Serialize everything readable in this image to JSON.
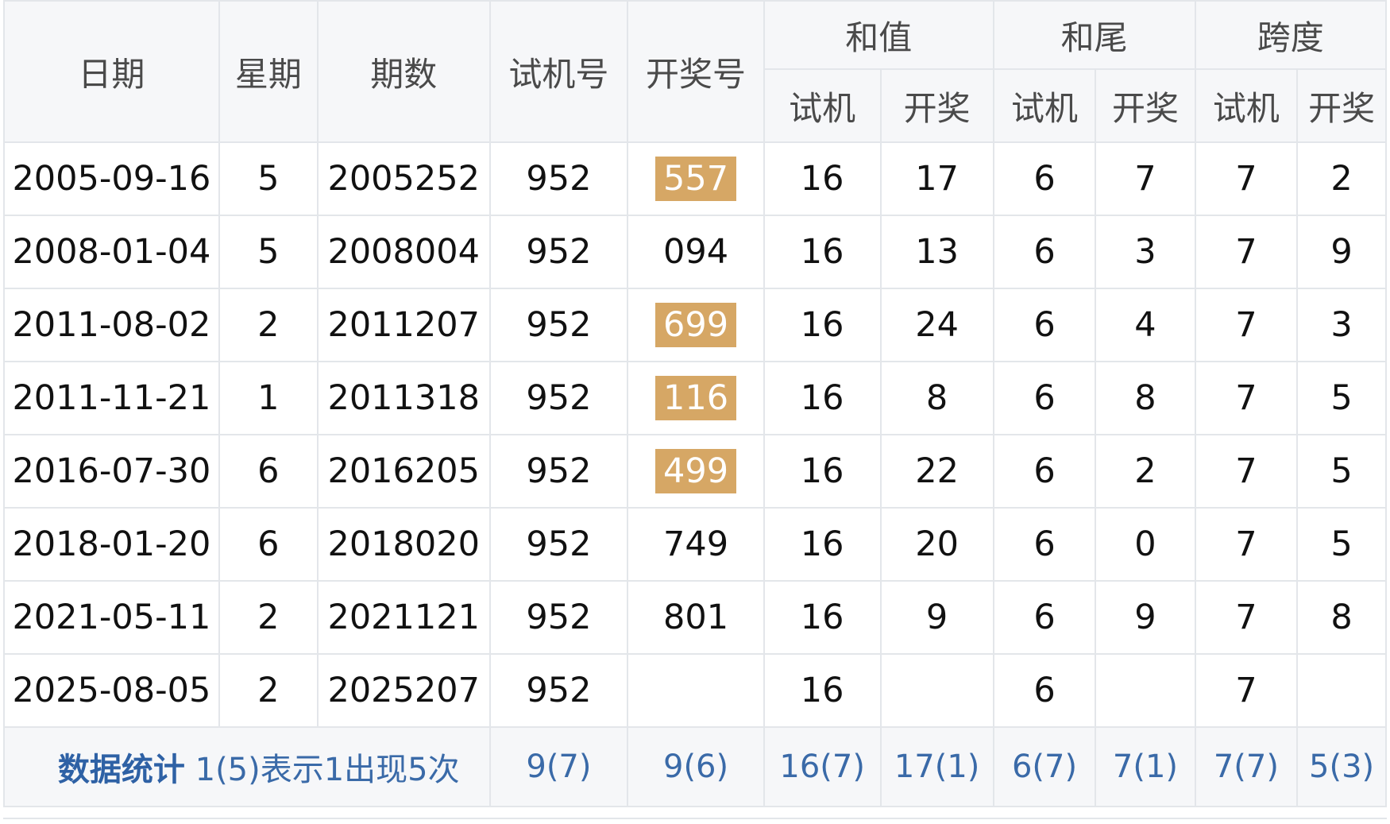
{
  "headers": {
    "date": "日期",
    "weekday": "星期",
    "period": "期数",
    "trial": "试机号",
    "draw": "开奖号",
    "sum": "和值",
    "tail": "和尾",
    "span": "跨度",
    "sub_trial": "试机",
    "sub_draw": "开奖"
  },
  "rows": [
    {
      "date": "2005-09-16",
      "weekday": "5",
      "period": "2005252",
      "trial": "952",
      "draw": "557",
      "highlight": true,
      "sum_t": "16",
      "sum_d": "17",
      "tail_t": "6",
      "tail_d": "7",
      "span_t": "7",
      "span_d": "2"
    },
    {
      "date": "2008-01-04",
      "weekday": "5",
      "period": "2008004",
      "trial": "952",
      "draw": "094",
      "highlight": false,
      "sum_t": "16",
      "sum_d": "13",
      "tail_t": "6",
      "tail_d": "3",
      "span_t": "7",
      "span_d": "9"
    },
    {
      "date": "2011-08-02",
      "weekday": "2",
      "period": "2011207",
      "trial": "952",
      "draw": "699",
      "highlight": true,
      "sum_t": "16",
      "sum_d": "24",
      "tail_t": "6",
      "tail_d": "4",
      "span_t": "7",
      "span_d": "3"
    },
    {
      "date": "2011-11-21",
      "weekday": "1",
      "period": "2011318",
      "trial": "952",
      "draw": "116",
      "highlight": true,
      "sum_t": "16",
      "sum_d": "8",
      "tail_t": "6",
      "tail_d": "8",
      "span_t": "7",
      "span_d": "5"
    },
    {
      "date": "2016-07-30",
      "weekday": "6",
      "period": "2016205",
      "trial": "952",
      "draw": "499",
      "highlight": true,
      "sum_t": "16",
      "sum_d": "22",
      "tail_t": "6",
      "tail_d": "2",
      "span_t": "7",
      "span_d": "5"
    },
    {
      "date": "2018-01-20",
      "weekday": "6",
      "period": "2018020",
      "trial": "952",
      "draw": "749",
      "highlight": false,
      "sum_t": "16",
      "sum_d": "20",
      "tail_t": "6",
      "tail_d": "0",
      "span_t": "7",
      "span_d": "5"
    },
    {
      "date": "2021-05-11",
      "weekday": "2",
      "period": "2021121",
      "trial": "952",
      "draw": "801",
      "highlight": false,
      "sum_t": "16",
      "sum_d": "9",
      "tail_t": "6",
      "tail_d": "9",
      "span_t": "7",
      "span_d": "8"
    },
    {
      "date": "2025-08-05",
      "weekday": "2",
      "period": "2025207",
      "trial": "952",
      "draw": "",
      "highlight": false,
      "sum_t": "16",
      "sum_d": "",
      "tail_t": "6",
      "tail_d": "",
      "span_t": "7",
      "span_d": ""
    }
  ],
  "stats": {
    "title": "数据统计",
    "note": "1(5)表示1出现5次",
    "trial": "9(7)",
    "draw": "9(6)",
    "sum_t": "16(7)",
    "sum_d": "17(1)",
    "tail_t": "6(7)",
    "tail_d": "7(1)",
    "span_t": "7(7)",
    "span_d": "5(3)"
  },
  "colors": {
    "highlight_bg": "#d6a765",
    "draw_red": "#c0272d",
    "stat_blue": "#2e61a5",
    "border": "#e3e6ea",
    "header_bg": "#f6f7f9"
  }
}
